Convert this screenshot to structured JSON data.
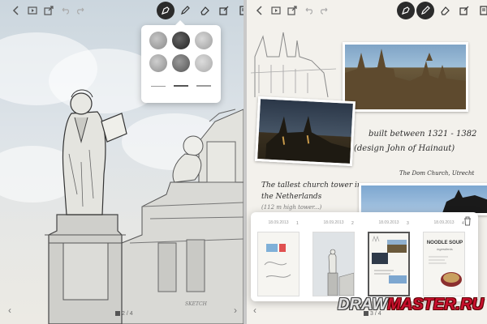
{
  "toolbar": {
    "buttons": [
      "back-arrow-icon",
      "present-icon",
      "share-icon",
      "undo-icon",
      "redo-icon"
    ],
    "tools": [
      "fountain-pen-icon",
      "pencil-icon",
      "eraser-icon",
      "export-icon",
      "journal-icon"
    ],
    "active_color": "#2b2b2b"
  },
  "palette": {
    "swatch_colors": [
      "#7a7a7a",
      "#3a3a3a",
      "#aaaaaa",
      "#8c8c8c",
      "#6a6a6a",
      "#b5b5b5"
    ],
    "tool_tips": [
      "pencil",
      "marker",
      "brush"
    ]
  },
  "left_page": {
    "signature": "SKETCH"
  },
  "right_page": {
    "caption_built": "built between 1321 - 1382",
    "caption_design": "(design John of Hainaut)",
    "caption_place": "The Dom Church, Utrecht",
    "caption_tallest_1": "The tallest church tower in",
    "caption_tallest_2": "the Netherlands",
    "caption_tallest_3": "(112 m high tower...)"
  },
  "tray": {
    "pages": [
      {
        "date": "18.09.2013",
        "number": "1"
      },
      {
        "date": "18.09.2013",
        "number": "2"
      },
      {
        "date": "18.09.2013",
        "number": "3"
      },
      {
        "date": "18.09.2013",
        "number": "4"
      }
    ],
    "page4_title": "NOODLE SOUP",
    "page4_sub": "ingredients"
  },
  "page_indicator_left": "2 / 4",
  "page_indicator_right": "3 / 4",
  "watermark": {
    "part1": "DRAW",
    "part2": "MASTER.RU"
  }
}
